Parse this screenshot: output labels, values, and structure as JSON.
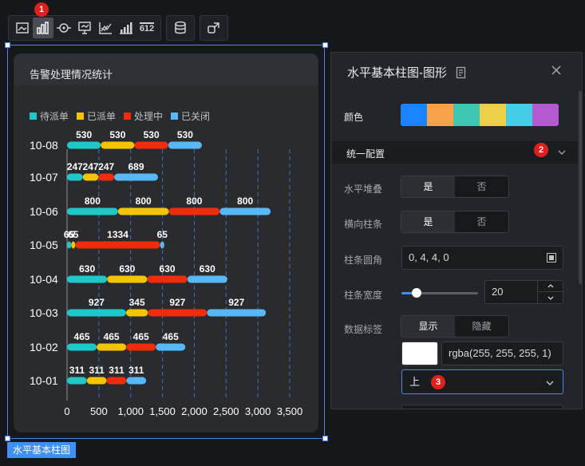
{
  "toolbar": {
    "groups": [
      [
        "picture-icon",
        "bar-chart-icon",
        "target-icon",
        "monitor-icon",
        "line-chart-icon",
        "bar-rise-icon",
        "number-icon"
      ],
      [
        "database-icon"
      ],
      [
        "share-icon"
      ]
    ],
    "active_icon": "bar-chart-icon",
    "number_icon_label": "612",
    "badge_1": "1"
  },
  "widget": {
    "tag": "水平基本柱图"
  },
  "card": {
    "title": "告警处理情况统计"
  },
  "chart_data": {
    "type": "bar",
    "orientation": "horizontal",
    "stacked": true,
    "categories": [
      "10-08",
      "10-07",
      "10-06",
      "10-05",
      "10-04",
      "10-03",
      "10-02",
      "10-01"
    ],
    "series": [
      {
        "name": "待派单",
        "color": "#1ec8c8",
        "values": [
          530,
          247,
          800,
          65,
          630,
          927,
          465,
          311
        ]
      },
      {
        "name": "已派单",
        "color": "#f5c400",
        "values": [
          530,
          247,
          800,
          65,
          630,
          345,
          465,
          311
        ]
      },
      {
        "name": "处理中",
        "color": "#f02c0c",
        "values": [
          530,
          247,
          800,
          1334,
          630,
          927,
          465,
          311
        ]
      },
      {
        "name": "已关闭",
        "color": "#57b8f5",
        "values": [
          530,
          689,
          800,
          65,
          630,
          927,
          465,
          311
        ]
      }
    ],
    "data_labels": [
      [
        "530",
        "530",
        "530",
        "530"
      ],
      [
        "247",
        "247",
        "247",
        "689"
      ],
      [
        "800",
        "800",
        "800",
        "800"
      ],
      [
        "65",
        "65",
        "1334",
        "65"
      ],
      [
        "630",
        "630",
        "630",
        "630"
      ],
      [
        "927",
        "345",
        "927",
        "927"
      ],
      [
        "465",
        "465",
        "465",
        "465"
      ],
      [
        "311",
        "311",
        "311",
        "311"
      ]
    ],
    "x_ticks": [
      "0",
      "500",
      "1,000",
      "1,500",
      "2,000",
      "2,500",
      "3,000",
      "3,500"
    ],
    "xlim": [
      0,
      3500
    ],
    "grid": "vertical dashed",
    "legend_position": "top-left"
  },
  "panel": {
    "title": "水平基本柱图-图形",
    "color_label": "颜色",
    "palette": [
      "#1a85ff",
      "#f7a249",
      "#3ec6b2",
      "#edcf48",
      "#44cde6",
      "#b35ad0"
    ],
    "section_title": "统一配置",
    "badge_2": "2",
    "rows": {
      "stack": {
        "label": "水平堆叠",
        "options": [
          "是",
          "否"
        ],
        "selected": "是"
      },
      "reverse": {
        "label": "横向柱条",
        "options": [
          "是",
          "否"
        ],
        "selected": "是"
      },
      "radius": {
        "label": "柱条圆角",
        "value": "0,  4,  4,  0"
      },
      "width": {
        "label": "柱条宽度",
        "value": "20",
        "slider_fraction": 0.2
      },
      "labels": {
        "label": "数据标签",
        "options": [
          "显示",
          "隐藏"
        ],
        "selected": "显示"
      }
    },
    "label_color": "rgba(255, 255, 255, 1)",
    "label_position": "上",
    "badge_3": "3"
  }
}
